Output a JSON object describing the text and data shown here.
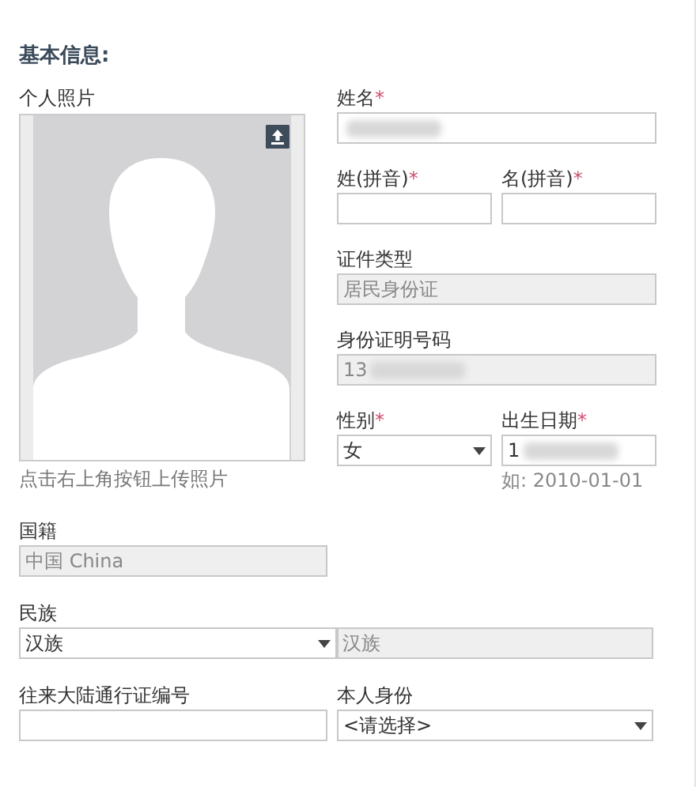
{
  "section_title": "基本信息:",
  "photo": {
    "label": "个人照片",
    "hint": "点击右上角按钮上传照片"
  },
  "right_rows": [
    [
      {
        "label": "姓名",
        "required_mark": "*",
        "controls": [
          {
            "kind": "text",
            "blurred": true
          }
        ]
      }
    ],
    [
      {
        "label": "姓(拼音)",
        "required_mark": "*",
        "controls": [
          {
            "kind": "text"
          }
        ]
      },
      {
        "label": "名(拼音)",
        "required_mark": "*",
        "controls": [
          {
            "kind": "text"
          }
        ]
      }
    ],
    [
      {
        "label": "证件类型",
        "controls": [
          {
            "kind": "readonly",
            "value": "居民身份证"
          }
        ]
      }
    ],
    [
      {
        "label": "身份证明号码",
        "controls": [
          {
            "kind": "readonly",
            "value": "13",
            "blurred": true
          }
        ]
      }
    ],
    [
      {
        "label": "性别",
        "required_mark": "*",
        "controls": [
          {
            "kind": "select",
            "value": "女"
          }
        ]
      },
      {
        "label": "出生日期",
        "required_mark": "*",
        "controls": [
          {
            "kind": "text",
            "value": "1",
            "blurred": true
          }
        ],
        "hint": "如: 2010-01-01"
      }
    ]
  ],
  "lower_rows": [
    [
      {
        "label": "国籍",
        "controls": [
          {
            "kind": "readonly",
            "value": "中国 China"
          }
        ]
      }
    ],
    [
      {
        "label": "民族",
        "controls": [
          {
            "kind": "select",
            "value": "汉族"
          },
          {
            "kind": "readonly",
            "value": "汉族"
          }
        ]
      }
    ],
    [
      {
        "label": "往来大陆通行证编号",
        "controls": [
          {
            "kind": "text"
          }
        ]
      },
      {
        "label": "本人身份",
        "controls": [
          {
            "kind": "select",
            "value": "<请选择>"
          }
        ]
      }
    ]
  ]
}
